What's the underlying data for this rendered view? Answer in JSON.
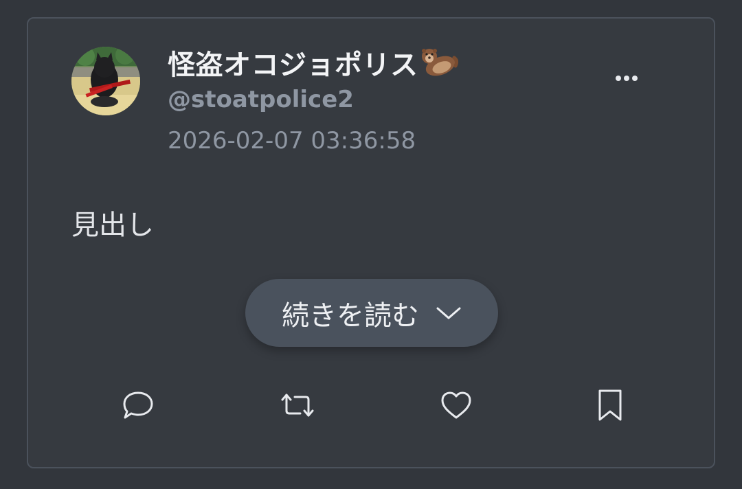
{
  "post": {
    "display_name": "怪盗オコジョポリス",
    "display_name_emoji": "otter-emoji",
    "username": "@stoatpolice2",
    "timestamp": "2026-02-07 03:36:58",
    "body": "見出し",
    "read_more_label": "続きを読む"
  },
  "actions": {
    "reply": "reply-icon",
    "repost": "repost-icon",
    "like": "heart-icon",
    "bookmark": "bookmark-icon"
  },
  "colors": {
    "background": "#32363c",
    "card": "#363a40",
    "card_border": "#4b525c",
    "text_primary": "#f3f4f6",
    "text_secondary": "#8f97a3",
    "button_bg": "#4a525d",
    "icon": "#e8eaee"
  }
}
